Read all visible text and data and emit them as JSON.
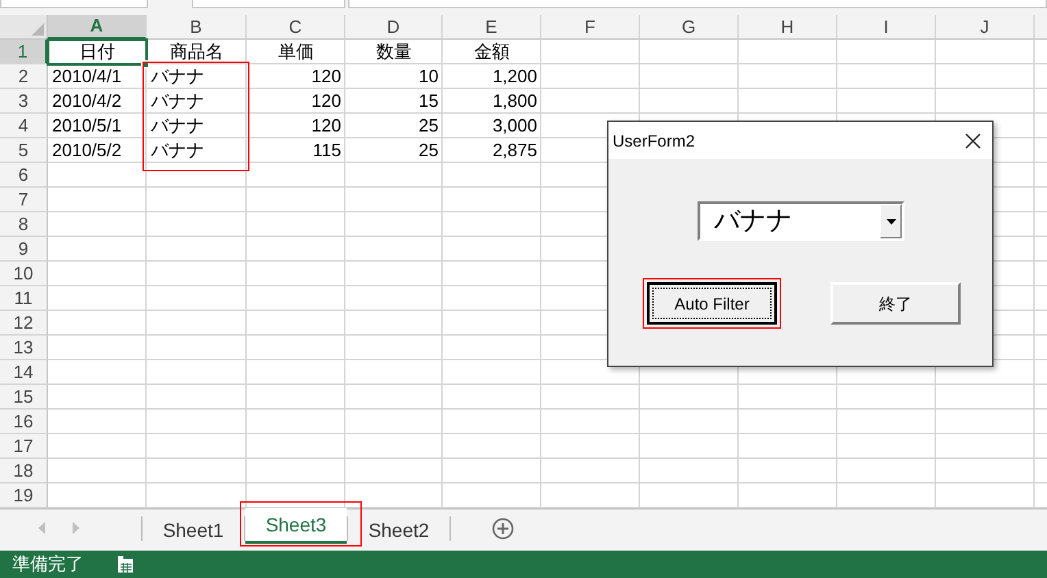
{
  "columns": [
    {
      "label": "A",
      "selected": true,
      "kind": "text",
      "framed": false
    },
    {
      "label": "B",
      "selected": false,
      "kind": "text",
      "framed": true
    },
    {
      "label": "C",
      "selected": false,
      "kind": "number",
      "framed": false
    },
    {
      "label": "D",
      "selected": false,
      "kind": "number",
      "framed": false
    },
    {
      "label": "E",
      "selected": false,
      "kind": "number",
      "framed": false
    },
    {
      "label": "F",
      "selected": false,
      "kind": "text",
      "framed": false
    },
    {
      "label": "G",
      "selected": false,
      "kind": "text",
      "framed": false
    },
    {
      "label": "H",
      "selected": false,
      "kind": "text",
      "framed": false
    },
    {
      "label": "I",
      "selected": false,
      "kind": "text",
      "framed": false
    },
    {
      "label": "J",
      "selected": false,
      "kind": "text",
      "framed": false
    }
  ],
  "rows": [
    {
      "number": "1",
      "selected": true,
      "kind": "header",
      "cells": [
        "日付",
        "商品名",
        "単価",
        "数量",
        "金額"
      ]
    },
    {
      "number": "2",
      "selected": false,
      "kind": "data",
      "cells": [
        "2010/4/1",
        "バナナ",
        "120",
        "10",
        "1,200"
      ]
    },
    {
      "number": "3",
      "selected": false,
      "kind": "data",
      "cells": [
        "2010/4/2",
        "バナナ",
        "120",
        "15",
        "1,800"
      ]
    },
    {
      "number": "4",
      "selected": false,
      "kind": "data",
      "cells": [
        "2010/5/1",
        "バナナ",
        "120",
        "25",
        "3,000"
      ]
    },
    {
      "number": "5",
      "selected": false,
      "kind": "data",
      "cells": [
        "2010/5/2",
        "バナナ",
        "115",
        "25",
        "2,875"
      ]
    },
    {
      "number": "6",
      "selected": false,
      "kind": "data",
      "cells": []
    },
    {
      "number": "7",
      "selected": false,
      "kind": "data",
      "cells": []
    },
    {
      "number": "8",
      "selected": false,
      "kind": "data",
      "cells": []
    },
    {
      "number": "9",
      "selected": false,
      "kind": "data",
      "cells": []
    },
    {
      "number": "10",
      "selected": false,
      "kind": "data",
      "cells": []
    },
    {
      "number": "11",
      "selected": false,
      "kind": "data",
      "cells": []
    },
    {
      "number": "12",
      "selected": false,
      "kind": "data",
      "cells": []
    },
    {
      "number": "13",
      "selected": false,
      "kind": "data",
      "cells": []
    },
    {
      "number": "14",
      "selected": false,
      "kind": "data",
      "cells": []
    },
    {
      "number": "15",
      "selected": false,
      "kind": "data",
      "cells": []
    },
    {
      "number": "16",
      "selected": false,
      "kind": "data",
      "cells": []
    },
    {
      "number": "17",
      "selected": false,
      "kind": "data",
      "cells": []
    },
    {
      "number": "18",
      "selected": false,
      "kind": "data",
      "cells": []
    },
    {
      "number": "19",
      "selected": false,
      "kind": "data",
      "cells": []
    }
  ],
  "sheet_tabs": [
    {
      "label": "Sheet1",
      "selected": false,
      "highlighted": false
    },
    {
      "label": "Sheet3",
      "selected": true,
      "highlighted": true
    },
    {
      "label": "Sheet2",
      "selected": false,
      "highlighted": false
    }
  ],
  "status_bar": {
    "text": "準備完了"
  },
  "dialog": {
    "title": "UserForm2",
    "combo_value": "バナナ",
    "buttons": [
      {
        "label": "Auto Filter",
        "focused": true,
        "highlighted": true
      },
      {
        "label": "終了",
        "focused": false,
        "highlighted": false
      }
    ]
  }
}
